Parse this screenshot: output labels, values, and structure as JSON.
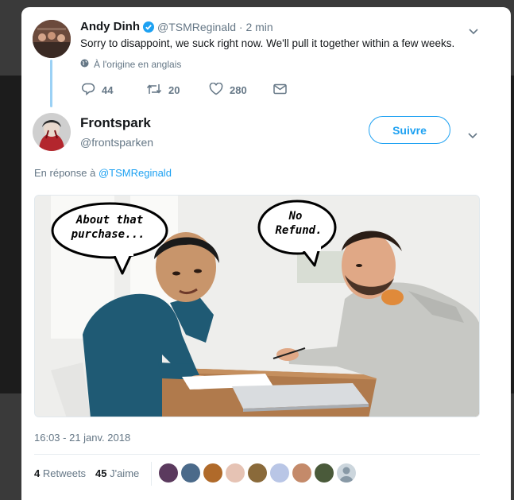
{
  "reply_tweet": {
    "author_name": "Andy Dinh",
    "handle_time": "@TSMReginald · 2 min",
    "text": "Sorry to disappoint, we suck right now. We'll pull it together within a few weeks.",
    "translation_note": "À l'origine en anglais",
    "replies": "44",
    "retweets": "20",
    "likes": "280"
  },
  "main_tweet": {
    "author_name": "Frontspark",
    "handle": "@frontsparken",
    "follow_label": "Suivre",
    "reply_prefix": "En réponse à",
    "reply_to": "@TSMReginald",
    "bubble_left_line1": "About that",
    "bubble_left_line2": "purchase...",
    "bubble_right_line1": "No",
    "bubble_right_line2": "Refund.",
    "timestamp": "16:03 - 21 janv. 2018",
    "retweet_count": "4",
    "retweet_label": "Retweets",
    "like_count": "45",
    "like_label": "J'aime"
  },
  "colors": {
    "accent": "#1da1f2",
    "verified": "#1da1f2",
    "thread_line": "#9bd1f5"
  }
}
